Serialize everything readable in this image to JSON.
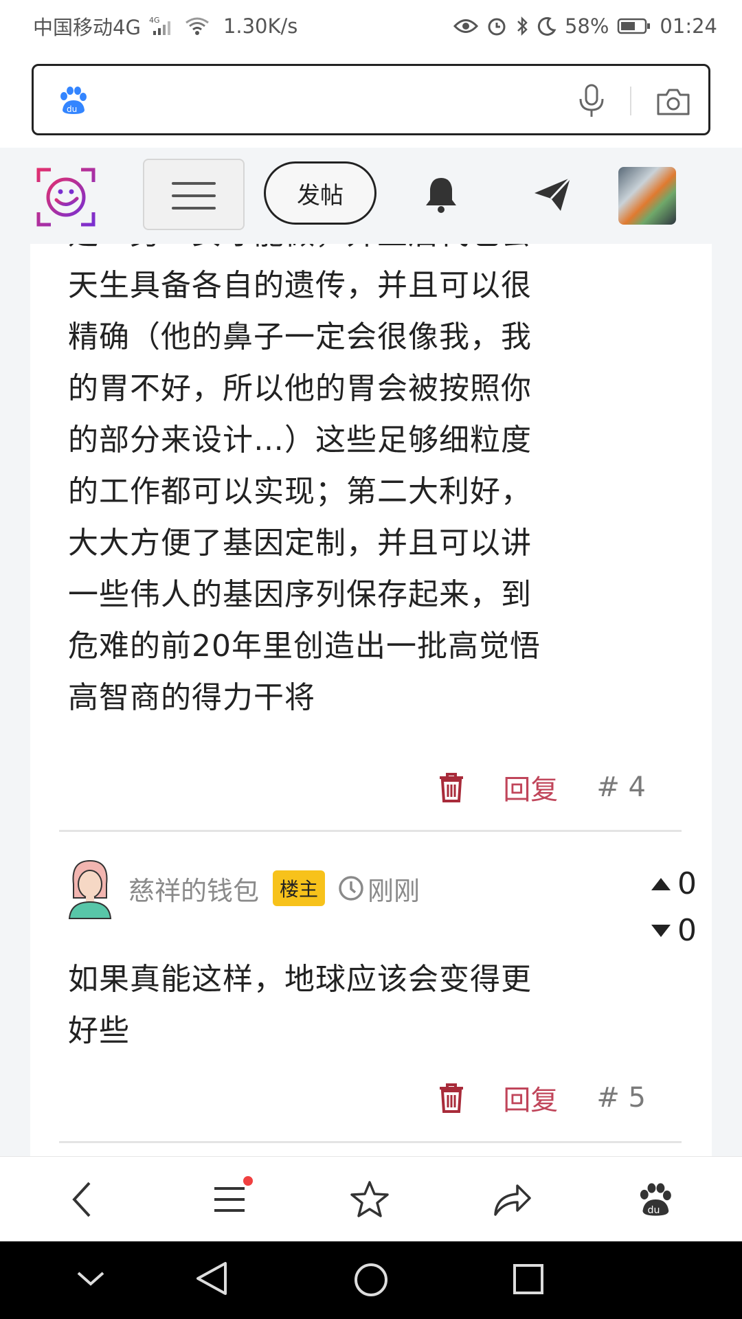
{
  "status_bar": {
    "carrier": "中国移动4G",
    "network_badge": "4G",
    "speed": "1.30K/s",
    "battery": "58%",
    "time": "01:24"
  },
  "search": {
    "placeholder": "",
    "value": ""
  },
  "header": {
    "post_label": "发帖"
  },
  "comments": [
    {
      "lines": [
        "是一男一女才能做，并且后代也会",
        "天生具备各自的遗传，并且可以很",
        "精确（他的鼻子一定会很像我，我",
        "的胃不好，所以他的胃会被按照你",
        "的部分来设计…）这些足够细粒度",
        "的工作都可以实现；第二大利好，",
        "大大方便了基因定制，并且可以讲",
        "一些伟人的基因序列保存起来，到",
        "危难的前20年里创造出一批高觉悟",
        "高智商的得力干将"
      ],
      "reply_label": "回复",
      "floor": "# 4"
    },
    {
      "author": "慈祥的钱包",
      "badge": "楼主",
      "time": "刚刚",
      "upvotes": "0",
      "downvotes": "0",
      "lines": [
        "如果真能这样，地球应该会变得更",
        "好些"
      ],
      "reply_label": "回复",
      "floor": "# 5"
    }
  ],
  "colors": {
    "reply": "#c0455a",
    "trash": "#a82b3a",
    "badge": "#f7c21b",
    "logo_gradient_start": "#e0306f",
    "logo_gradient_end": "#7a2fd0"
  }
}
